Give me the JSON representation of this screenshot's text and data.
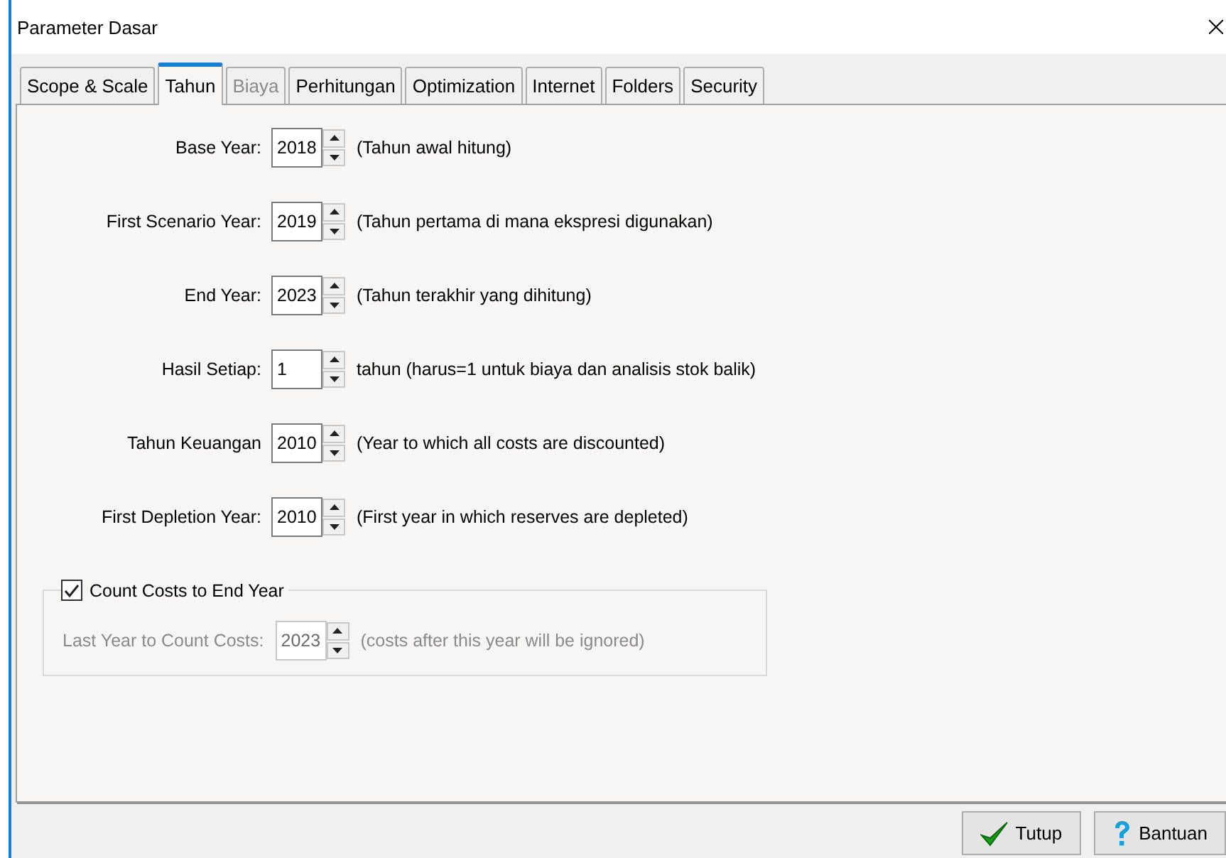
{
  "window": {
    "title": "Parameter Dasar"
  },
  "tabs": [
    {
      "label": "Scope & Scale",
      "selected": false,
      "disabled": false
    },
    {
      "label": "Tahun",
      "selected": true,
      "disabled": false
    },
    {
      "label": "Biaya",
      "selected": false,
      "disabled": true
    },
    {
      "label": "Perhitungan",
      "selected": false,
      "disabled": false
    },
    {
      "label": "Optimization",
      "selected": false,
      "disabled": false
    },
    {
      "label": "Internet",
      "selected": false,
      "disabled": false
    },
    {
      "label": "Folders",
      "selected": false,
      "disabled": false
    },
    {
      "label": "Security",
      "selected": false,
      "disabled": false
    }
  ],
  "fields": [
    {
      "label": "Base Year:",
      "value": "2018",
      "note": "(Tahun awal hitung)"
    },
    {
      "label": "First Scenario Year:",
      "value": "2019",
      "note": "(Tahun pertama di mana ekspresi digunakan)"
    },
    {
      "label": "End Year:",
      "value": "2023",
      "note": "(Tahun terakhir yang dihitung)"
    },
    {
      "label": "Hasil Setiap:",
      "value": "1",
      "note": "tahun (harus=1 untuk biaya dan analisis stok balik)"
    },
    {
      "label": "Tahun Keuangan",
      "value": "2010",
      "note": "(Year to which all costs are  discounted)"
    },
    {
      "label": "First Depletion Year:",
      "value": "2010",
      "note": "(First year in which reserves are depleted)"
    }
  ],
  "group": {
    "label": "Count Costs to End Year",
    "checked": true,
    "field": {
      "label": "Last Year to Count Costs:",
      "value": "2023",
      "note": "(costs after this year will be ignored)",
      "disabled": true
    }
  },
  "buttons": [
    {
      "label": "Tutup",
      "kind": "check"
    },
    {
      "label": "Bantuan",
      "kind": "help"
    }
  ]
}
